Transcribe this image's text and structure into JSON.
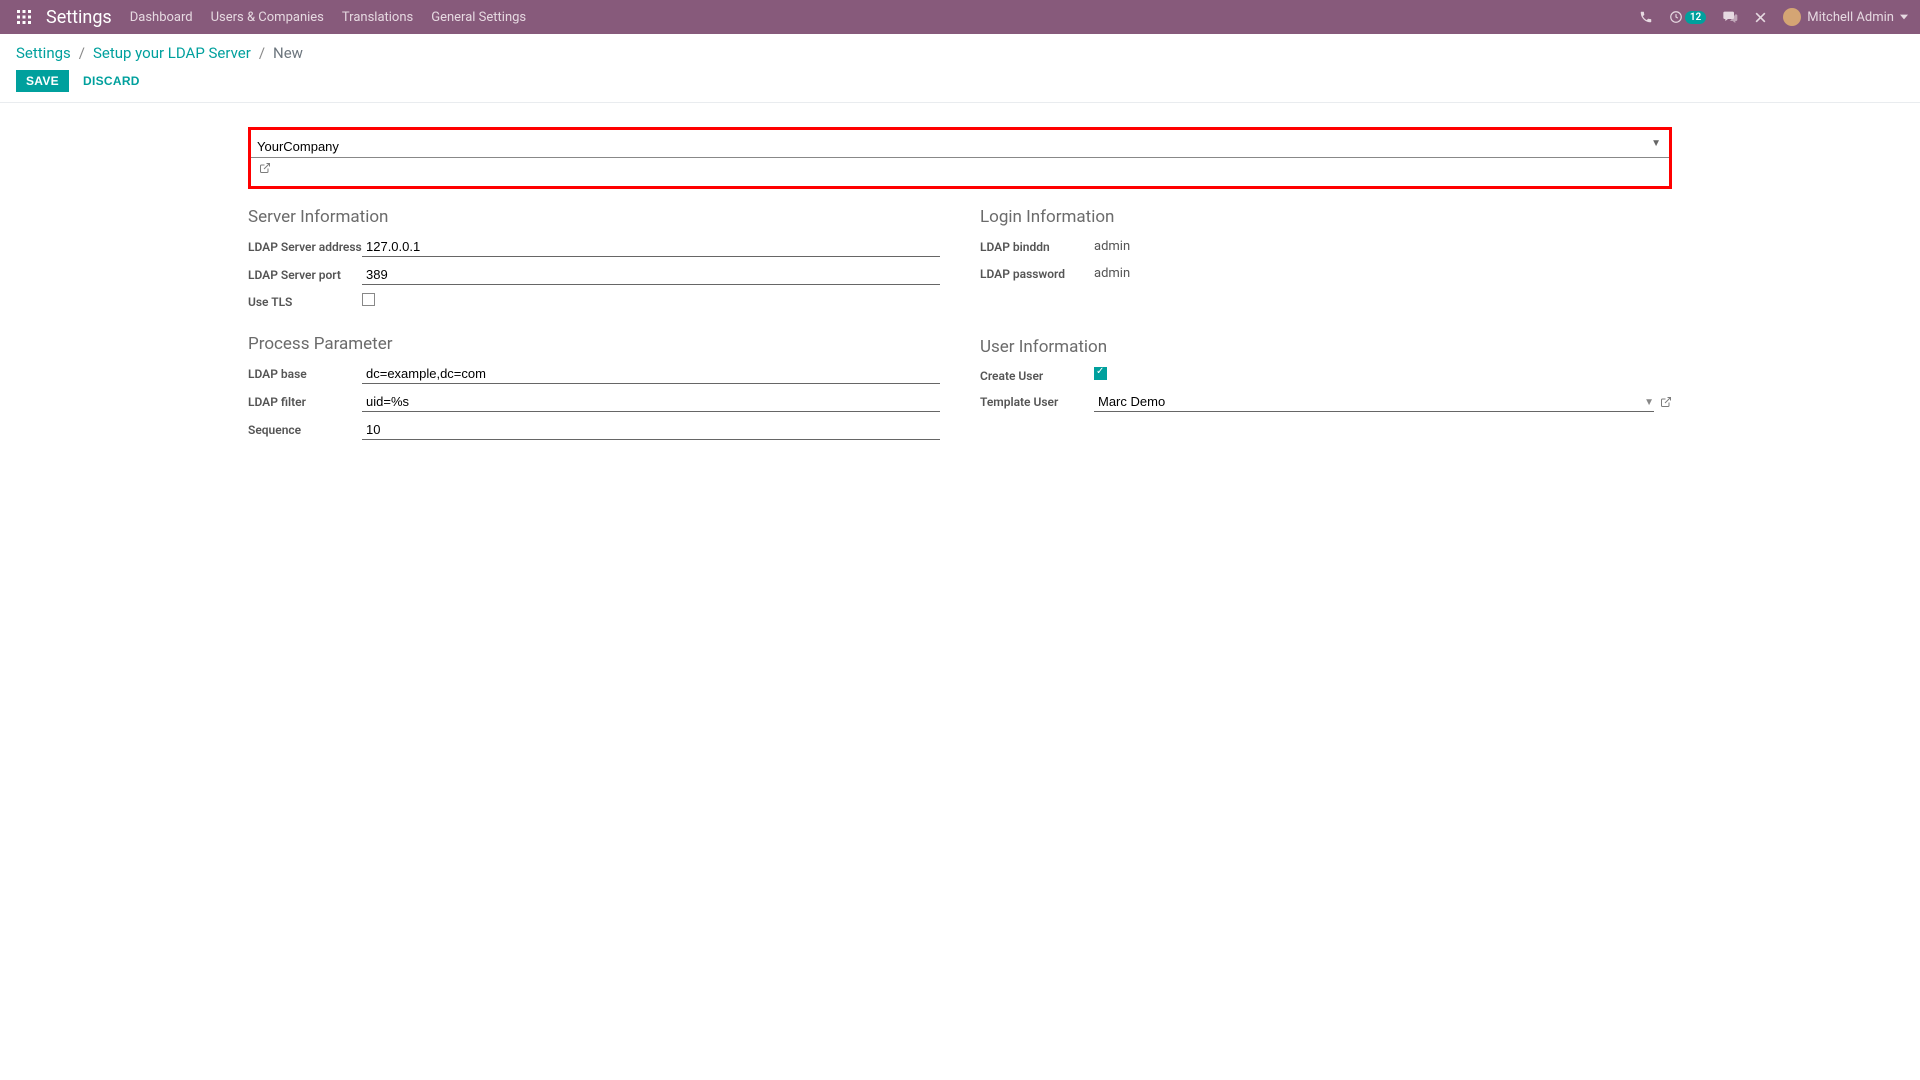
{
  "navbar": {
    "app_title": "Settings",
    "menu": [
      "Dashboard",
      "Users & Companies",
      "Translations",
      "General Settings"
    ],
    "activity_count": "12",
    "user_name": "Mitchell Admin"
  },
  "breadcrumb": {
    "root": "Settings",
    "parent": "Setup your LDAP Server",
    "current": "New"
  },
  "buttons": {
    "save": "SAVE",
    "discard": "DISCARD"
  },
  "form": {
    "company": "YourCompany",
    "sections": {
      "server_info_title": "Server Information",
      "login_info_title": "Login Information",
      "process_param_title": "Process Parameter",
      "user_info_title": "User Information"
    },
    "labels": {
      "ldap_server_address": "LDAP Server address",
      "ldap_server_port": "LDAP Server port",
      "use_tls": "Use TLS",
      "ldap_binddn": "LDAP binddn",
      "ldap_password": "LDAP password",
      "ldap_base": "LDAP base",
      "ldap_filter": "LDAP filter",
      "sequence": "Sequence",
      "create_user": "Create User",
      "template_user": "Template User"
    },
    "values": {
      "ldap_server_address": "127.0.0.1",
      "ldap_server_port": "389",
      "use_tls": false,
      "ldap_binddn": "admin",
      "ldap_password": "admin",
      "ldap_base": "dc=example,dc=com",
      "ldap_filter": "uid=%s",
      "sequence": "10",
      "create_user": true,
      "template_user": "Marc Demo"
    }
  }
}
